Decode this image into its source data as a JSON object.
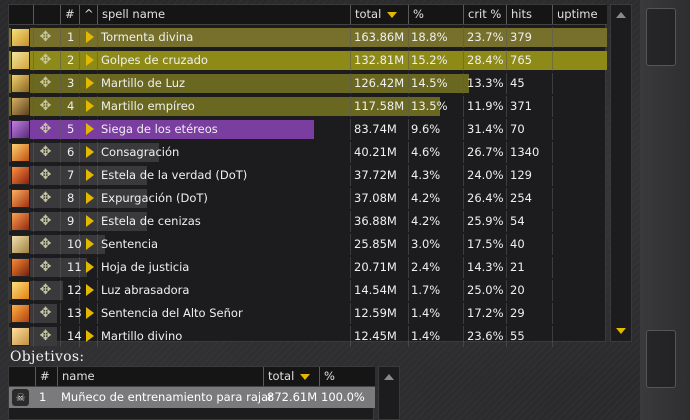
{
  "colors": {
    "paladin_fill": "#6f6b1e",
    "paladin_bright_fill": "#8d8a18",
    "purple_fill": "#7a3da0",
    "dark_fill": "#3a3a3c",
    "accent_arrow": "#e2b800"
  },
  "spells_table": {
    "headers": {
      "index": "#",
      "caret": "^",
      "name": "spell name",
      "total": "total",
      "pct": "%",
      "crit": "crit %",
      "hits": "hits",
      "uptime": "uptime"
    },
    "rows": [
      {
        "idx": "1",
        "name": "Tormenta divina",
        "total": "163.86M",
        "pct": "18.8%",
        "crit": "23.7%",
        "hits": "379",
        "fill": 1.0,
        "color": "#76702c",
        "icon": "storm-icon"
      },
      {
        "idx": "2",
        "name": "Golpes de cruzado",
        "total": "132.81M",
        "pct": "15.2%",
        "crit": "28.4%",
        "hits": "765",
        "fill": 1.0,
        "color": "#8d8a18",
        "icon": "crusader-strike-icon"
      },
      {
        "idx": "3",
        "name": "Martillo de Luz",
        "total": "126.42M",
        "pct": "14.5%",
        "crit": "13.3%",
        "hits": "45",
        "fill": 0.77,
        "color": "#6a6720",
        "icon": "hammer-icon"
      },
      {
        "idx": "4",
        "name": "Martillo empíreo",
        "total": "117.58M",
        "pct": "13.5%",
        "crit": "11.9%",
        "hits": "371",
        "fill": 0.72,
        "color": "#6a6720",
        "icon": "empyrean-hammer-icon"
      },
      {
        "idx": "5",
        "name": "Siega de los etéreos",
        "total": "83.74M",
        "pct": "9.6%",
        "crit": "31.4%",
        "hits": "70",
        "fill": 0.51,
        "color": "#7a3da0",
        "icon": "reap-icon"
      },
      {
        "idx": "6",
        "name": "Consagración",
        "total": "40.21M",
        "pct": "4.6%",
        "crit": "26.7%",
        "hits": "1340",
        "fill": 0.25,
        "color": "#3a3a3c",
        "icon": "consecration-icon"
      },
      {
        "idx": "7",
        "name": "Estela de la verdad (DoT)",
        "total": "37.72M",
        "pct": "4.3%",
        "crit": "24.0%",
        "hits": "129",
        "fill": 0.23,
        "color": "#3a3a3c",
        "icon": "truth-icon"
      },
      {
        "idx": "8",
        "name": "Expurgación (DoT)",
        "total": "37.08M",
        "pct": "4.2%",
        "crit": "26.4%",
        "hits": "254",
        "fill": 0.23,
        "color": "#3a3a3c",
        "icon": "expurgation-icon"
      },
      {
        "idx": "9",
        "name": "Estela de cenizas",
        "total": "36.88M",
        "pct": "4.2%",
        "crit": "25.9%",
        "hits": "54",
        "fill": 0.23,
        "color": "#3a3a3c",
        "icon": "ashes-icon"
      },
      {
        "idx": "10",
        "name": "Sentencia",
        "total": "25.85M",
        "pct": "3.0%",
        "crit": "17.5%",
        "hits": "40",
        "fill": 0.16,
        "color": "#3a3a3c",
        "icon": "judgment-icon"
      },
      {
        "idx": "11",
        "name": "Hoja de justicia",
        "total": "20.71M",
        "pct": "2.4%",
        "crit": "14.3%",
        "hits": "21",
        "fill": 0.13,
        "color": "#3a3a3c",
        "icon": "blade-icon"
      },
      {
        "idx": "12",
        "name": "Luz abrasadora",
        "total": "14.54M",
        "pct": "1.7%",
        "crit": "25.0%",
        "hits": "20",
        "fill": 0.09,
        "color": "#3a3a3c",
        "icon": "searing-light-icon"
      },
      {
        "idx": "13",
        "name": "Sentencia del Alto Señor",
        "total": "12.59M",
        "pct": "1.4%",
        "crit": "17.2%",
        "hits": "29",
        "fill": 0.08,
        "color": "#3a3a3c",
        "icon": "highlord-icon"
      },
      {
        "idx": "14",
        "name": "Martillo divino",
        "total": "12.45M",
        "pct": "1.4%",
        "crit": "23.6%",
        "hits": "55",
        "fill": 0.08,
        "color": "#3a3a3c",
        "icon": "divine-hammer-icon"
      }
    ]
  },
  "targets": {
    "title": "Objetivos:",
    "headers": {
      "index": "#",
      "name": "name",
      "total": "total",
      "pct": "%"
    },
    "rows": [
      {
        "idx": "1",
        "name": "Muñeco de entrenamiento para rajar",
        "total": "872.61M",
        "pct": "100.0%"
      }
    ]
  }
}
